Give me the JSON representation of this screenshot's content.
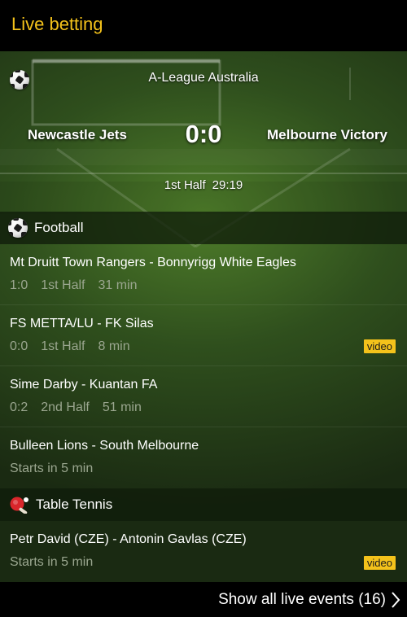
{
  "header": {
    "title": "Live betting"
  },
  "featured": {
    "league": "A-League Australia",
    "home_team": "Newcastle Jets",
    "away_team": "Melbourne Victory",
    "score": "0:0",
    "period": "1st Half",
    "clock": "29:19"
  },
  "sections": [
    {
      "label": "Football",
      "icon": "football-icon",
      "events": [
        {
          "title": "Mt Druitt Town Rangers - Bonnyrigg White Eagles",
          "score": "1:0",
          "period": "1st Half",
          "time": "31 min",
          "video": false
        },
        {
          "title": "FS METTA/LU - FK Silas",
          "score": "0:0",
          "period": "1st Half",
          "time": "8 min",
          "video": true
        },
        {
          "title": "Sime Darby - Kuantan FA",
          "score": "0:2",
          "period": "2nd Half",
          "time": "51 min",
          "video": false
        },
        {
          "title": "Bulleen Lions - South Melbourne",
          "starts": "Starts in 5 min",
          "video": false
        }
      ]
    },
    {
      "label": "Table Tennis",
      "icon": "table-tennis-icon",
      "events": [
        {
          "title": "Petr David (CZE) - Antonin Gavlas (CZE)",
          "starts": "Starts in 5 min",
          "video": true
        }
      ]
    }
  ],
  "video_label": "video",
  "footer": {
    "label": "Show all live events (16)"
  },
  "colors": {
    "accent": "#f4c21b",
    "muted_text": "#9aa68f",
    "background": "#000000"
  }
}
